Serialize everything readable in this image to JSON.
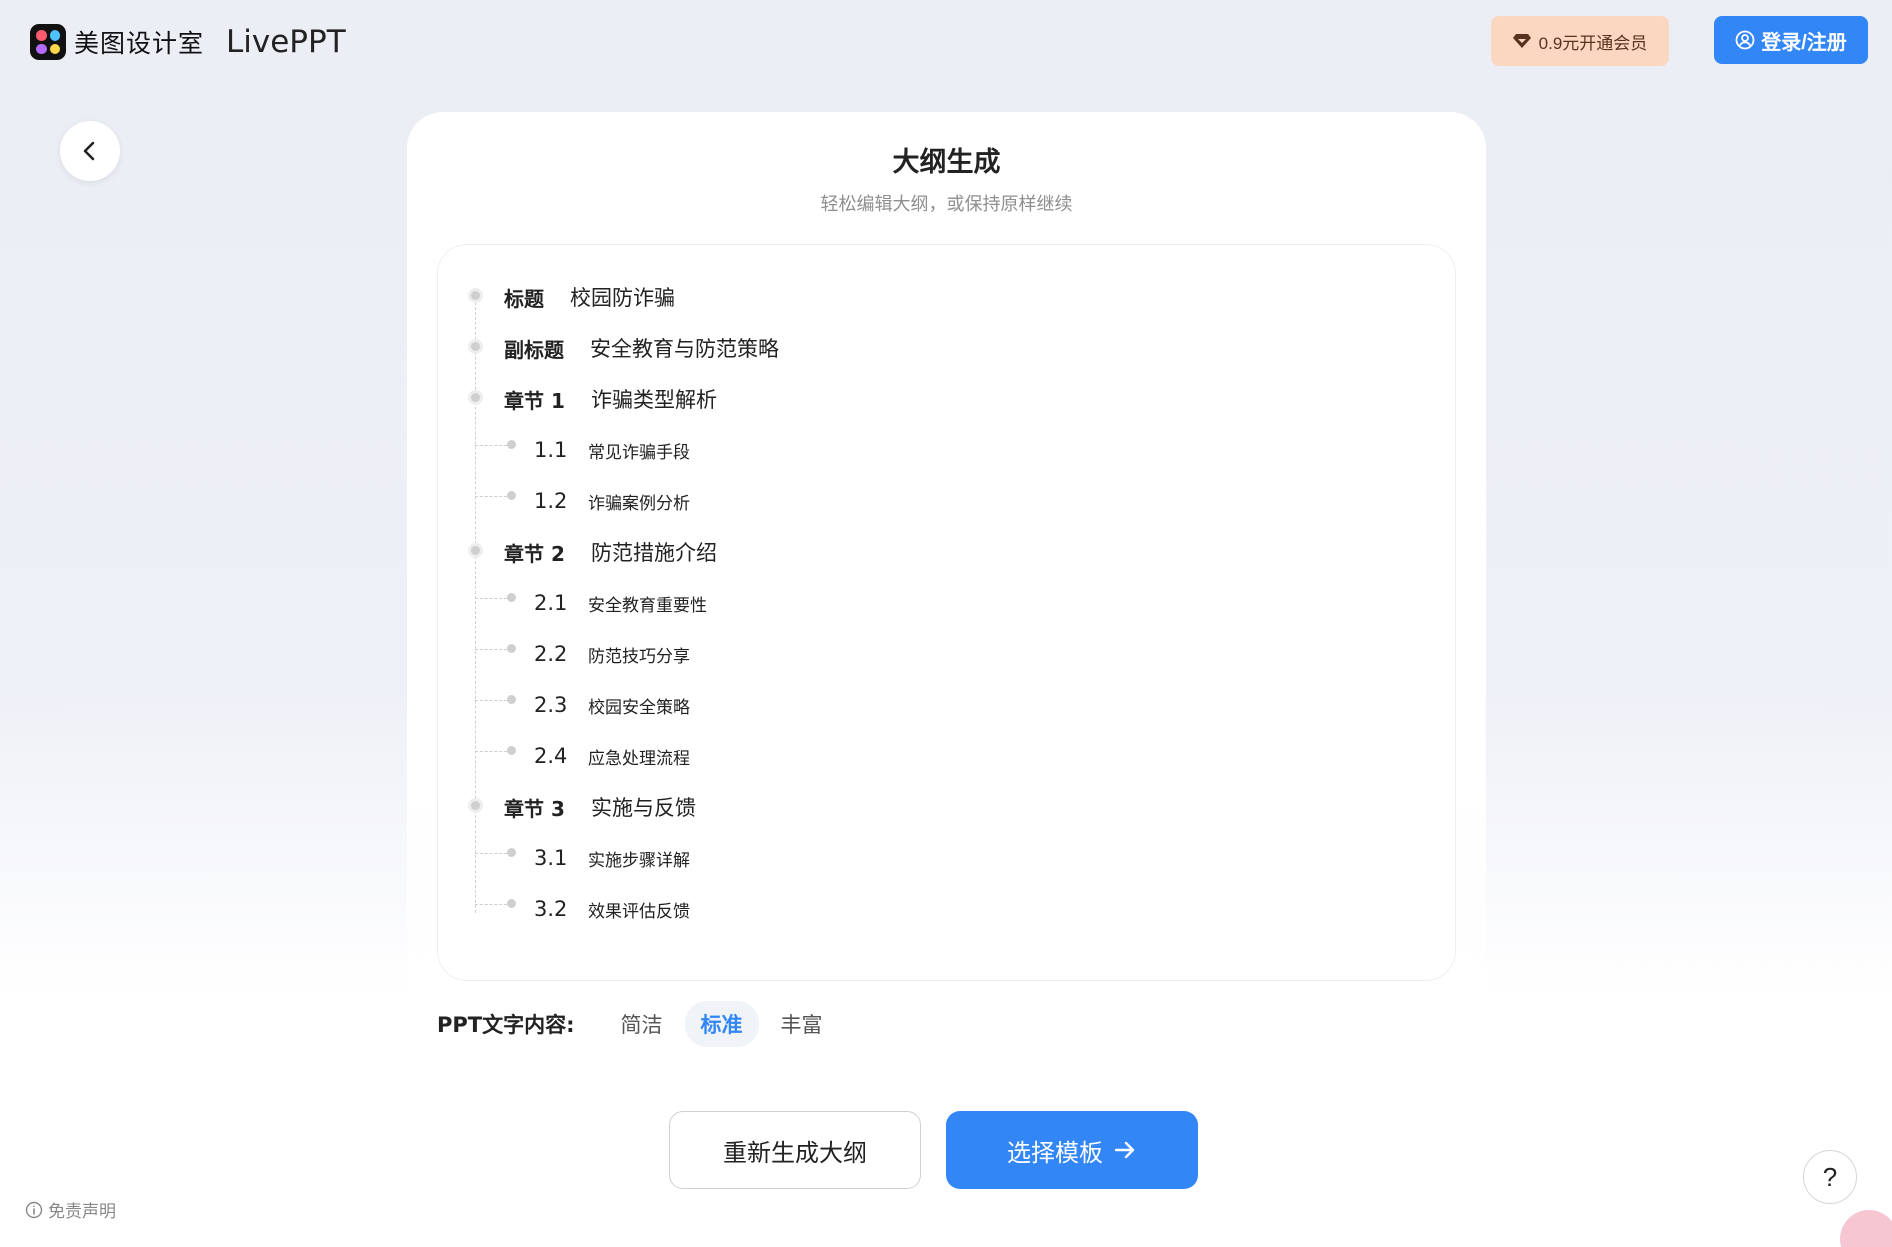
{
  "header": {
    "brand_name": "美图设计室",
    "app_name": "LivePPT",
    "vip_label": "0.9元开通会员",
    "login_label": "登录/注册"
  },
  "page": {
    "title": "大纲生成",
    "subtitle": "轻松编辑大纲，或保持原样继续"
  },
  "outline": {
    "items": [
      {
        "level": "top",
        "num": "标题",
        "text": "校园防诈骗"
      },
      {
        "level": "top",
        "num": "副标题",
        "text": "安全教育与防范策略"
      },
      {
        "level": "top",
        "num": "章节 1",
        "text": "诈骗类型解析"
      },
      {
        "level": "sub",
        "num": "1.1",
        "text": "常见诈骗手段"
      },
      {
        "level": "sub",
        "num": "1.2",
        "text": "诈骗案例分析"
      },
      {
        "level": "top",
        "num": "章节 2",
        "text": "防范措施介绍"
      },
      {
        "level": "sub",
        "num": "2.1",
        "text": "安全教育重要性"
      },
      {
        "level": "sub",
        "num": "2.2",
        "text": "防范技巧分享"
      },
      {
        "level": "sub",
        "num": "2.3",
        "text": "校园安全策略"
      },
      {
        "level": "sub",
        "num": "2.4",
        "text": "应急处理流程"
      },
      {
        "level": "top",
        "num": "章节 3",
        "text": "实施与反馈"
      },
      {
        "level": "sub",
        "num": "3.1",
        "text": "实施步骤详解"
      },
      {
        "level": "sub",
        "num": "3.2",
        "text": "效果评估反馈"
      }
    ]
  },
  "content_level": {
    "label": "PPT文字内容:",
    "options": [
      "简洁",
      "标准",
      "丰富"
    ],
    "selected": "标准"
  },
  "actions": {
    "regenerate_label": "重新生成大纲",
    "next_label": "选择模板"
  },
  "footer": {
    "disclaimer": "免责声明",
    "help": "?"
  },
  "colors": {
    "accent": "#3286f6",
    "vip_bg": "#fbd7bf"
  }
}
